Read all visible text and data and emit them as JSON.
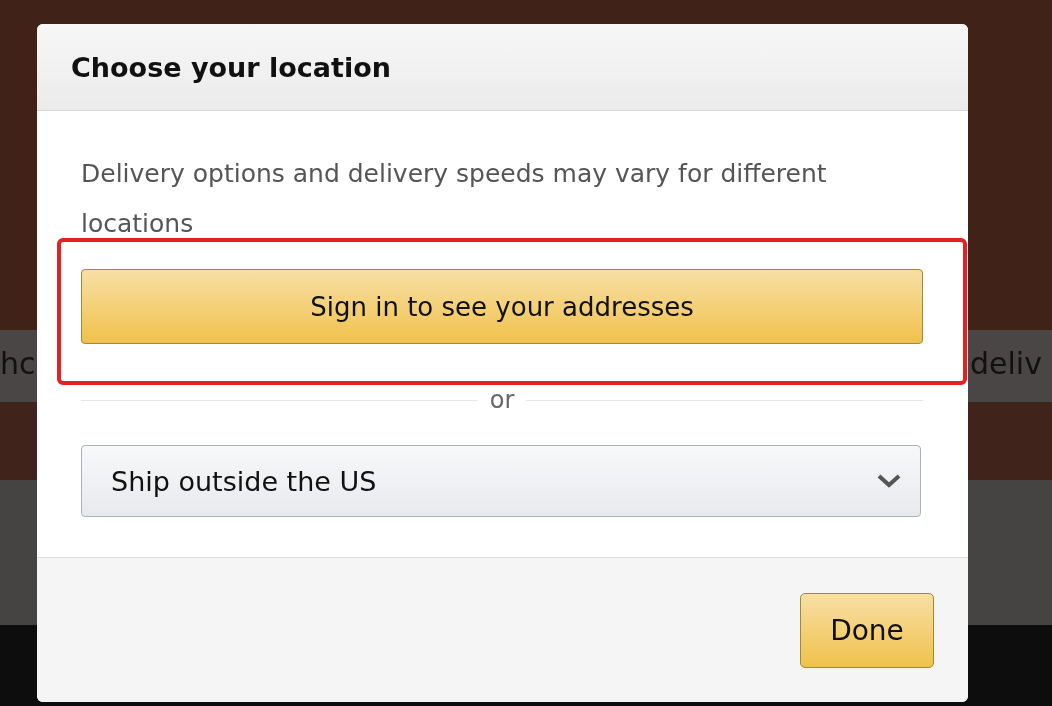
{
  "background": {
    "fragments": [
      "hc",
      "deliv"
    ]
  },
  "dialog": {
    "title": "Choose your location",
    "message": "Delivery options and delivery speeds may vary for different locations",
    "primary_button": "Sign in to see your addresses",
    "separator": "or",
    "dropdown": {
      "value": "Ship outside the US"
    },
    "done_button": "Done"
  }
}
